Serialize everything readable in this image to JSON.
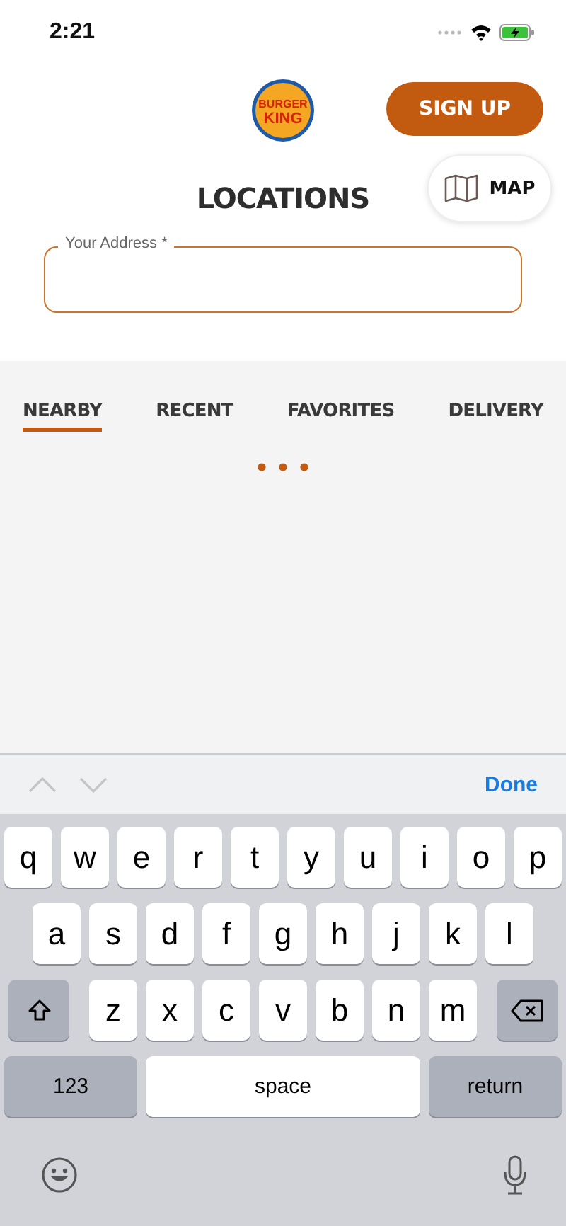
{
  "status_bar": {
    "time": "2:21"
  },
  "header": {
    "logo": {
      "line_1": "BURGER",
      "line_2": "KING"
    },
    "sign_up_button": "SIGN UP",
    "map_button": "MAP",
    "title": "LOCATIONS"
  },
  "address_field": {
    "label": "Your Address *"
  },
  "tabs": [
    {
      "label": "NEARBY",
      "selected": true
    },
    {
      "label": "RECENT",
      "selected": false
    },
    {
      "label": "FAVORITES",
      "selected": false
    },
    {
      "label": "DELIVERY",
      "selected": false
    }
  ],
  "keyboard_toolbar": {
    "done": "Done"
  },
  "keyboard": {
    "rows": [
      {
        "keys": [
          {
            "kind": "letter",
            "label": "q"
          },
          {
            "kind": "letter",
            "label": "w"
          },
          {
            "kind": "letter",
            "label": "e"
          },
          {
            "kind": "letter",
            "label": "r"
          },
          {
            "kind": "letter",
            "label": "t"
          },
          {
            "kind": "letter",
            "label": "y"
          },
          {
            "kind": "letter",
            "label": "u"
          },
          {
            "kind": "letter",
            "label": "i"
          },
          {
            "kind": "letter",
            "label": "o"
          },
          {
            "kind": "letter",
            "label": "p"
          }
        ]
      },
      {
        "keys": [
          {
            "kind": "letter",
            "label": "a"
          },
          {
            "kind": "letter",
            "label": "s"
          },
          {
            "kind": "letter",
            "label": "d"
          },
          {
            "kind": "letter",
            "label": "f"
          },
          {
            "kind": "letter",
            "label": "g"
          },
          {
            "kind": "letter",
            "label": "h"
          },
          {
            "kind": "letter",
            "label": "j"
          },
          {
            "kind": "letter",
            "label": "k"
          },
          {
            "kind": "letter",
            "label": "l"
          }
        ]
      },
      {
        "keys": [
          {
            "kind": "shift"
          },
          {
            "kind": "letter",
            "label": "z"
          },
          {
            "kind": "letter",
            "label": "x"
          },
          {
            "kind": "letter",
            "label": "c"
          },
          {
            "kind": "letter",
            "label": "v"
          },
          {
            "kind": "letter",
            "label": "b"
          },
          {
            "kind": "letter",
            "label": "n"
          },
          {
            "kind": "letter",
            "label": "m"
          },
          {
            "kind": "backspace"
          }
        ]
      },
      {
        "keys": [
          {
            "kind": "mode",
            "label": "123"
          },
          {
            "kind": "space",
            "label": "space"
          },
          {
            "kind": "mode",
            "label": "return"
          }
        ]
      }
    ]
  }
}
